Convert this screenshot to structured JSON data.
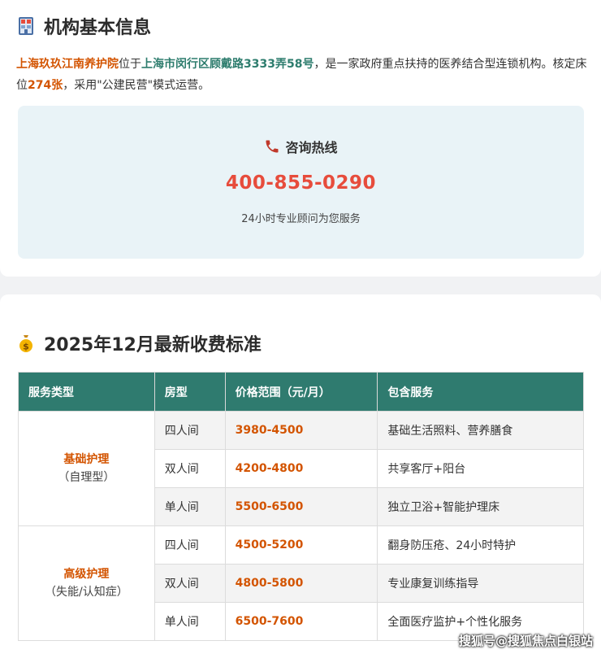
{
  "section1": {
    "title": "机构基本信息",
    "intro": {
      "name": "上海玖玖江南养护院",
      "t1": "位于",
      "address": "上海市闵行区顾戴路3333弄58号",
      "t2": "，是一家政府重点扶持的医养结合型连锁机构。核定床位",
      "beds": "274张",
      "t3": "，采用\"公建民营\"模式运营。"
    },
    "hotline": {
      "title": "咨询热线",
      "phone": "400-855-0290",
      "note": "24小时专业顾问为您服务"
    }
  },
  "section2": {
    "title": "2025年12月最新收费标准",
    "headers": [
      "服务类型",
      "房型",
      "价格范围（元/月）",
      "包含服务"
    ],
    "groups": [
      {
        "name": "基础护理",
        "sub": "（自理型）",
        "rows": [
          {
            "room": "四人间",
            "price": "3980-4500",
            "service": "基础生活照料、营养膳食"
          },
          {
            "room": "双人间",
            "price": "4200-4800",
            "service": "共享客厅+阳台"
          },
          {
            "room": "单人间",
            "price": "5500-6500",
            "service": "独立卫浴+智能护理床"
          }
        ]
      },
      {
        "name": "高级护理",
        "sub": "（失能/认知症）",
        "rows": [
          {
            "room": "四人间",
            "price": "4500-5200",
            "service": "翻身防压疮、24小时特护"
          },
          {
            "room": "双人间",
            "price": "4800-5800",
            "service": "专业康复训练指导"
          },
          {
            "room": "单人间",
            "price": "6500-7600",
            "service": "全面医疗监护+个性化服务"
          }
        ]
      }
    ]
  },
  "watermark": "搜狐号@搜狐焦点白银站",
  "colors": {
    "accent_orange": "#d35400",
    "teal": "#2f7b6f",
    "phone_red": "#e74c3c",
    "hotline_bg": "#e9f3f7"
  }
}
